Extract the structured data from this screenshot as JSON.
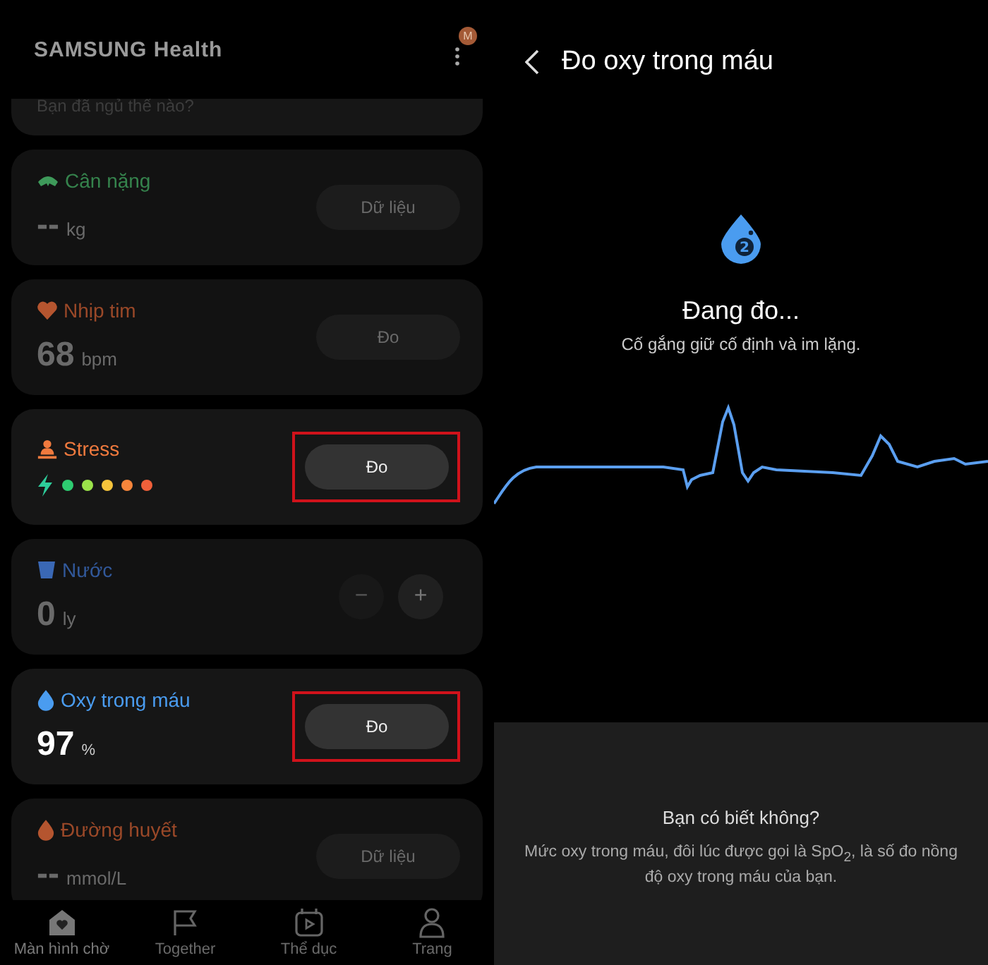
{
  "left": {
    "app_title": "SAMSUNG Health",
    "avatar": "M",
    "sleep_prompt": "Bạn đã ngủ thế nào?",
    "cards": [
      {
        "kind": "button",
        "title": "Cân nặng",
        "color": "#3e9a5a",
        "value": "--",
        "unit": "kg",
        "action": "Dữ liệu",
        "dimmed": true,
        "highlighted": false
      },
      {
        "kind": "button",
        "title": "Nhịp tim",
        "color": "#b5552f",
        "value": "68",
        "unit": "bpm",
        "action": "Đo",
        "dimmed": true,
        "highlighted": false
      },
      {
        "kind": "stress",
        "title": "Stress",
        "color": "#f07a3e",
        "action": "Đo",
        "dimmed": false,
        "highlighted": true,
        "dots": [
          {
            "color": "#2ecc71"
          },
          {
            "color": "#9be24a"
          },
          {
            "color": "#f5c33b"
          },
          {
            "color": "#f7853b"
          },
          {
            "color": "#f0603a"
          }
        ]
      },
      {
        "kind": "water",
        "title": "Nước",
        "color": "#3a68b5",
        "value": "0",
        "unit": "ly",
        "minus": "−",
        "plus": "+",
        "dimmed": true,
        "highlighted": false
      },
      {
        "kind": "button",
        "title": "Oxy trong máu",
        "color": "#4a9cf0",
        "value": "97",
        "unit": "%",
        "action": "Đo",
        "dimmed": false,
        "highlighted": true
      },
      {
        "kind": "button",
        "title": "Đường huyết",
        "color": "#b5552f",
        "value": "--",
        "unit": "mmol/L",
        "action": "Dữ liệu",
        "dimmed": true,
        "highlighted": false
      }
    ],
    "nav": [
      {
        "label": "Màn hình chờ",
        "selected": true
      },
      {
        "label": "Together",
        "selected": false
      },
      {
        "label": "Thể dục",
        "selected": false
      },
      {
        "label": "Trang",
        "selected": false
      }
    ]
  },
  "right": {
    "title": "Đo oxy trong máu",
    "icon_badge": "2",
    "status": "Đang đo...",
    "hint": "Cố gắng giữ cố định và im lặng.",
    "info_title": "Bạn có biết không?",
    "info_text": "Mức oxy trong máu, đôi lúc được gọi là SpO$_{2}$, là số đo nồng độ oxy trong máu của bạn."
  }
}
